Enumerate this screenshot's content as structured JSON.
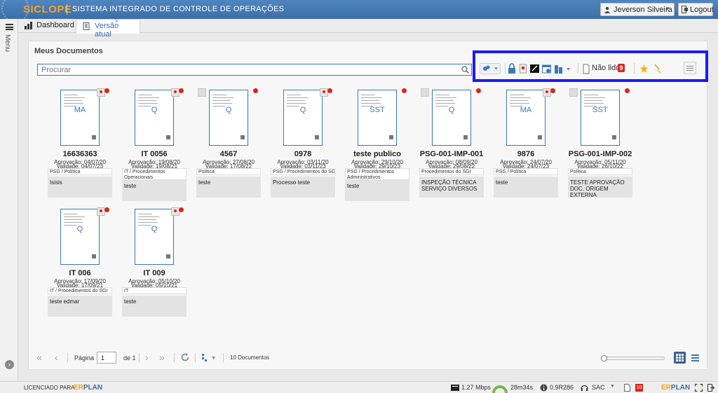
{
  "app": {
    "brand": "SICLOPE",
    "system_title": "SISTEMA INTEGRADO DE CONTROLE DE OPERAÇÕES",
    "user_name": "Jeverson Silveira",
    "logout_label": "Logout",
    "menu_label": "Menu"
  },
  "tabs": [
    {
      "label": "Dashboard"
    },
    {
      "label": "Versão atual"
    }
  ],
  "panel": {
    "title": "Meus Documentos",
    "search_placeholder": "Procurar"
  },
  "toolbar": {
    "unread_label": "Não lidos",
    "unread_count": "9"
  },
  "documents": [
    {
      "code": "MA",
      "name": "16636363",
      "approval": "Aprovação: 04/07/20",
      "validity": "Validade: 04/07/23",
      "category": "PSG / Política",
      "description": "Isisis"
    },
    {
      "code": "Q",
      "name": "IT 0056",
      "approval": "Aprovação: 19/08/20",
      "validity": "Validade: 19/08/21",
      "category": "IT / Procedimentos Operacionais",
      "description": "teste"
    },
    {
      "code": "Q",
      "name": "4567",
      "approval": "Aprovação: 27/08/20",
      "validity": "Validade: 17/08/22",
      "category": "Política",
      "description": "teste"
    },
    {
      "code": "Q",
      "name": "0978",
      "approval": "Aprovação: 03/11/20",
      "validity": "Validade: 03/11/23",
      "category": "PSG / Procedimentos do SGI",
      "description": "Processo teste"
    },
    {
      "code": "SST",
      "name": "teste publico",
      "approval": "Aprovação: 29/10/20",
      "validity": "Validade: 29/10/23",
      "category": "PSG / Procedimentos Administrativos",
      "description": "teste"
    },
    {
      "code": "Q",
      "name": "PSG-001-IMP-001",
      "approval": "Aprovação: 08/09/20",
      "validity": "Validade: 29/08/22",
      "category": "Procedimentos do SGI",
      "description": "INSPEÇÃO TÉCNICA SERVIÇO DIVERSOS"
    },
    {
      "code": "MA",
      "name": "9876",
      "approval": "Aprovação: 24/07/20",
      "validity": "Validade: 24/07/23",
      "category": "PSG / Política",
      "description": "teste"
    },
    {
      "code": "SST",
      "name": "PSG-001-IMP-002",
      "approval": "Aprovação: 05/11/20",
      "validity": "Validade: 26/10/22",
      "category": "Política",
      "description": "TESTE APROVAÇÃO DOC. ORIGEM EXTERNA"
    },
    {
      "code": "Q",
      "name": "IT 006",
      "approval": "Aprovação: 17/09/20",
      "validity": "Validade: 17/09/21",
      "category": "IT / Procedimentos do SGI",
      "description": "teste edmar"
    },
    {
      "code": "Q",
      "name": "IT 009",
      "approval": "Aprovação: 05/10/20",
      "validity": "Validade: 05/10/21",
      "category": "IT",
      "description": "teste"
    }
  ],
  "pager": {
    "page_label": "Página",
    "page_value": "1",
    "of_label": "de 1",
    "count_label": "10 Documentos"
  },
  "statusbar": {
    "licensed_label": "LICENCIADO PARA:",
    "erplan_prefix": "ER",
    "erplan_suffix": "PLAN",
    "speed": "1.27 Mbps",
    "timer": "28m34s",
    "version": "0.9R286",
    "sac": "SAC",
    "calendar_day": "10"
  },
  "colors": {
    "topbar": "#3b6ea8",
    "brand": "#f7a21b",
    "highlight_frame": "#1c1cf0",
    "badge": "#d9261c"
  }
}
